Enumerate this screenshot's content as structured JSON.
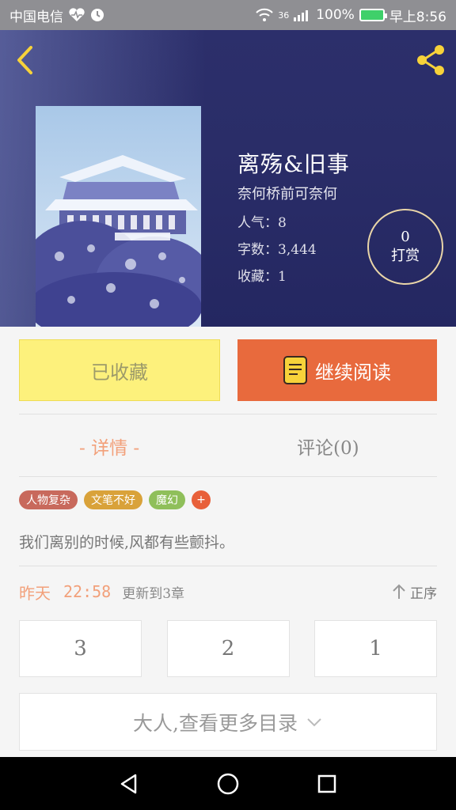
{
  "status_bar": {
    "carrier": "中国电信",
    "network": "36",
    "battery": "100%",
    "time": "早上8:56"
  },
  "book": {
    "title": "离殇&旧事",
    "author": "奈何桥前可奈何",
    "popularity": "人气：8",
    "word_count": "字数：3,444",
    "favorites": "收藏：1"
  },
  "reward": {
    "count": "0",
    "label": "打赏"
  },
  "actions": {
    "collected_label": "已收藏",
    "continue_label": "继续阅读"
  },
  "tabs": {
    "details": "-  详情  -",
    "comments": "评论(0)"
  },
  "tags": [
    {
      "label": "人物复杂",
      "color": "#c8695c"
    },
    {
      "label": "文笔不好",
      "color": "#d9a23a"
    },
    {
      "label": "魔幻",
      "color": "#8fbf5a"
    }
  ],
  "tag_add": "+",
  "intro": "我们离别的时候,风都有些颤抖。",
  "update": {
    "when": "昨天",
    "time": "22:58",
    "note": "更新到3章",
    "sort_label": "正序"
  },
  "chapters": [
    "3",
    "2",
    "1"
  ],
  "more_label": "大人,查看更多目录",
  "colors": {
    "accent": "#e86a3d",
    "collected": "#fdf17c",
    "hero": "#2c2f6b"
  }
}
